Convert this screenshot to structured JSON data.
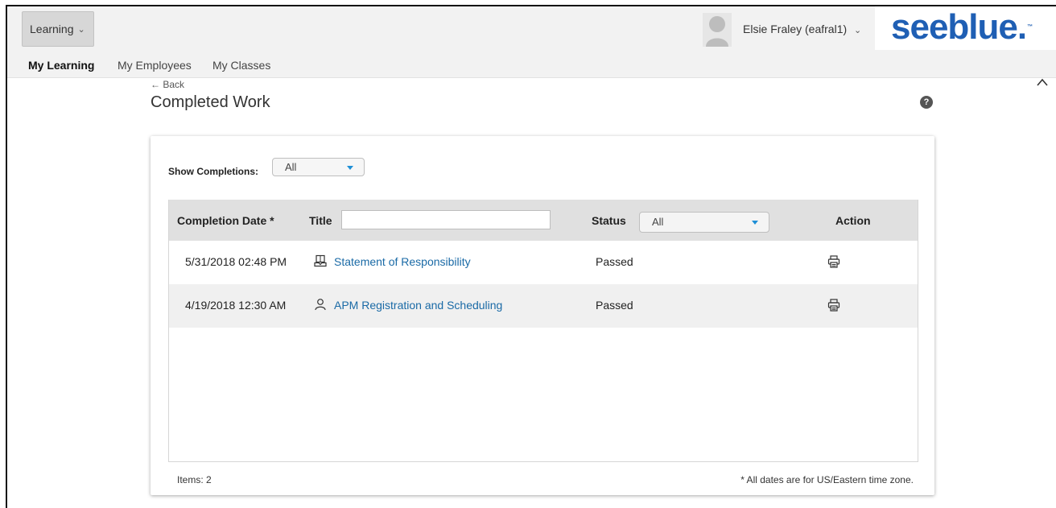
{
  "header": {
    "module_menu": {
      "label": "Learning",
      "icon": "chevron-down-icon"
    },
    "user": {
      "name": "Elsie Fraley (eafral1)",
      "icon": "chevron-down-icon",
      "avatar": "user-avatar-placeholder"
    },
    "logo": {
      "text": "seeblue.",
      "tm": "™",
      "color": "#1f5fb4"
    }
  },
  "nav": {
    "tabs": [
      {
        "label": "My Learning",
        "active": true
      },
      {
        "label": "My Employees",
        "active": false
      },
      {
        "label": "My Classes",
        "active": false
      }
    ]
  },
  "page": {
    "back_label": "← Back",
    "title": "Completed Work",
    "help_icon": "question-icon",
    "help_glyph": "?"
  },
  "filters": {
    "show_completions_label": "Show Completions:",
    "show_completions_value": "All"
  },
  "table": {
    "columns": {
      "completion_date": "Completion Date *",
      "title": "Title",
      "status": "Status",
      "action": "Action"
    },
    "title_filter_value": "",
    "status_filter_value": "All",
    "rows": [
      {
        "date": "5/31/2018 02:48 PM",
        "title": "Statement of Responsibility",
        "type_icon": "online-course-icon",
        "status": "Passed",
        "action_icon": "print-icon"
      },
      {
        "date": "4/19/2018 12:30 AM",
        "title": "APM Registration and Scheduling",
        "type_icon": "person-icon",
        "status": "Passed",
        "action_icon": "print-icon"
      }
    ]
  },
  "footer": {
    "items_label": "Items: 2",
    "timezone_note": "* All dates are for US/Eastern time zone."
  },
  "colors": {
    "accent": "#1e8fd6",
    "link": "#1a6aa6",
    "header_bg": "#f2f2f2",
    "table_header_bg": "#e0e0e0"
  }
}
